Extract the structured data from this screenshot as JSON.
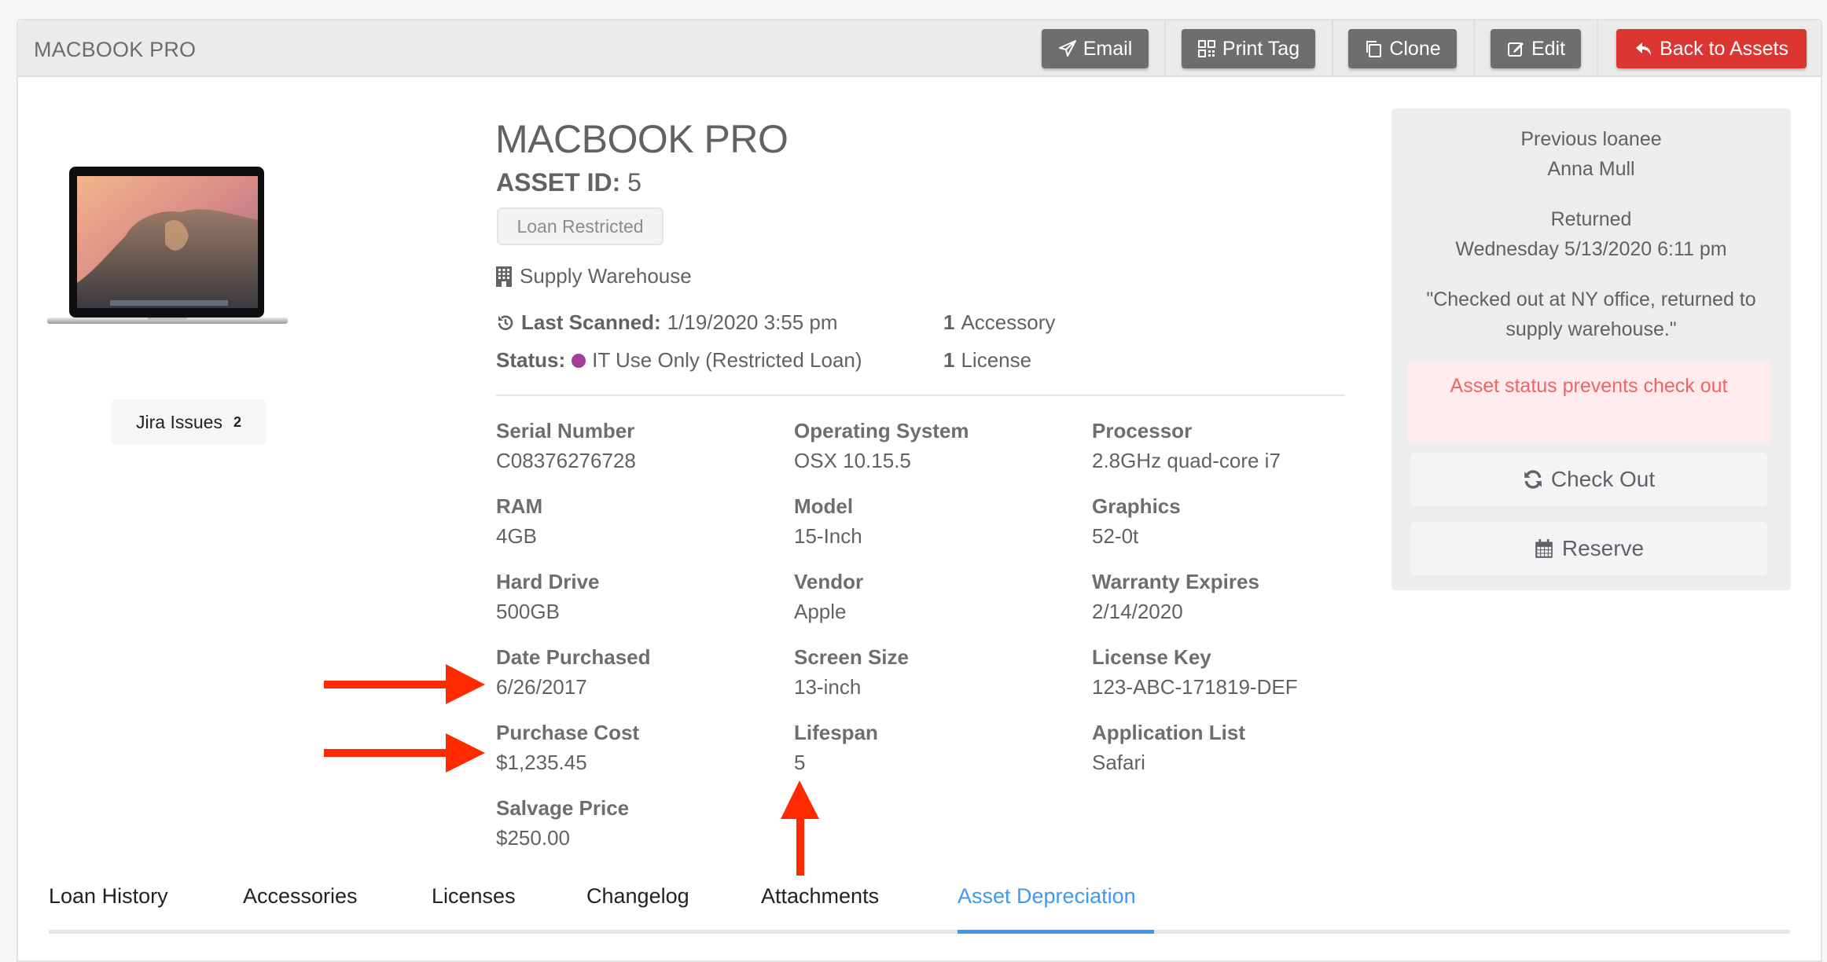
{
  "header": {
    "title": "MACBOOK PRO",
    "buttons": {
      "email": "Email",
      "print_tag": "Print Tag",
      "clone": "Clone",
      "edit": "Edit",
      "back": "Back to Assets"
    }
  },
  "jira": {
    "label": "Jira Issues",
    "count": "2"
  },
  "asset": {
    "name": "MACBOOK PRO",
    "id_label": "ASSET ID:",
    "id_value": "5",
    "badge": "Loan Restricted",
    "location": "Supply Warehouse",
    "last_scanned_label": "Last Scanned:",
    "last_scanned_value": "1/19/2020 3:55 pm",
    "status_label": "Status:",
    "status_value": "IT Use Only (Restricted Loan)",
    "status_color": "#a23f9a",
    "accessory_count": "1",
    "accessory_label": "Accessory",
    "license_count": "1",
    "license_label": "License"
  },
  "fields": [
    {
      "label": "Serial Number",
      "value": "C08376276728"
    },
    {
      "label": "Operating System",
      "value": "OSX 10.15.5"
    },
    {
      "label": "Processor",
      "value": "2.8GHz quad-core i7"
    },
    {
      "label": "RAM",
      "value": "4GB"
    },
    {
      "label": "Model",
      "value": "15-Inch"
    },
    {
      "label": "Graphics",
      "value": "52-0t"
    },
    {
      "label": "Hard Drive",
      "value": "500GB"
    },
    {
      "label": "Vendor",
      "value": "Apple"
    },
    {
      "label": "Warranty Expires",
      "value": "2/14/2020"
    },
    {
      "label": "Date Purchased",
      "value": "6/26/2017"
    },
    {
      "label": "Screen Size",
      "value": "13-inch"
    },
    {
      "label": "License Key",
      "value": "123-ABC-171819-DEF"
    },
    {
      "label": "Purchase Cost",
      "value": "$1,235.45"
    },
    {
      "label": "Lifespan",
      "value": "5"
    },
    {
      "label": "Application List",
      "value": "Safari"
    },
    {
      "label": "Salvage Price",
      "value": "$250.00"
    }
  ],
  "side_panel": {
    "previous_loanee_label": "Previous loanee",
    "previous_loanee": "Anna Mull",
    "returned_label": "Returned",
    "returned_value": "Wednesday 5/13/2020 6:11 pm",
    "note_line1": "\"Checked out at NY office, returned to",
    "note_line2": "supply warehouse.\"",
    "alert": "Asset status prevents check out",
    "check_out": "Check Out",
    "reserve": "Reserve"
  },
  "tabs": [
    {
      "label": "Loan History",
      "active": false
    },
    {
      "label": "Accessories",
      "active": false
    },
    {
      "label": "Licenses",
      "active": false
    },
    {
      "label": "Changelog",
      "active": false
    },
    {
      "label": "Attachments",
      "active": false
    },
    {
      "label": "Asset Depreciation",
      "active": true
    }
  ],
  "colors": {
    "primary_button": "#6e6e6e",
    "danger_button": "#dc3633",
    "active_tab": "#3d9af0",
    "annotation_arrow": "#ff2a00"
  }
}
